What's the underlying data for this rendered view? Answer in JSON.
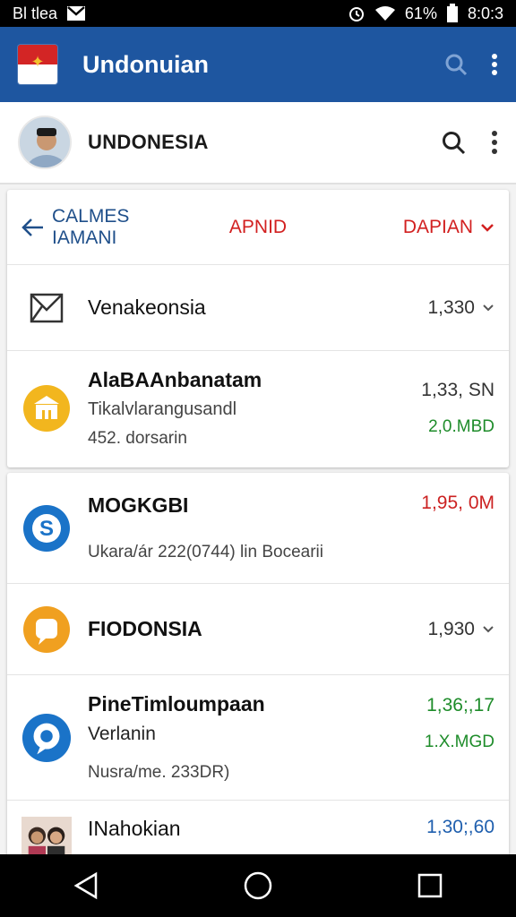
{
  "status_bar": {
    "left_text": "Bl tlea",
    "battery": "61%",
    "time": "8:0:3"
  },
  "app_bar": {
    "title": "Undonuian",
    "actions": [
      "search-icon",
      "more-vert-icon"
    ]
  },
  "profile": {
    "name": "UNDONESIA"
  },
  "tabs": {
    "back_label": "CALMES IAMANI",
    "middle_label": "APNID",
    "right_label": "DAPIAN"
  },
  "rows": [
    {
      "icon": "mail-icon",
      "title": "Venakeonsia",
      "amount": "1,330"
    },
    {
      "icon": "bank-icon",
      "title": "AlaBAAnbanatam",
      "subtitle": "Tikalvlarangusandl",
      "subtitle2": "452. dorsarin",
      "amount": "1,33, SN",
      "amount2": "2,0.MBD"
    },
    {
      "icon": "s-coin-icon",
      "title": "MOGKGBI",
      "subtitle2": "Ukara/ár 222(0744) lin Bocearii",
      "amount": "1,95, 0M"
    },
    {
      "icon": "orange-chat-icon",
      "title": "FIODONSIA",
      "amount": "1,930"
    },
    {
      "icon": "blue-chat-icon",
      "title": "PineTimloumpaan",
      "subtitle": "Verlanin",
      "subtitle2": "Nusra/me. 233DR)",
      "amount": "1,36;,17",
      "amount2": "1.X.MGD"
    },
    {
      "icon": "people-photo-icon",
      "title": "INahokian",
      "amount": "1,30;,60"
    }
  ],
  "colors": {
    "app_bar": "#1e56a0",
    "accent_red": "#d22020",
    "green": "#1e8c2a",
    "blue": "#1f5fae"
  }
}
